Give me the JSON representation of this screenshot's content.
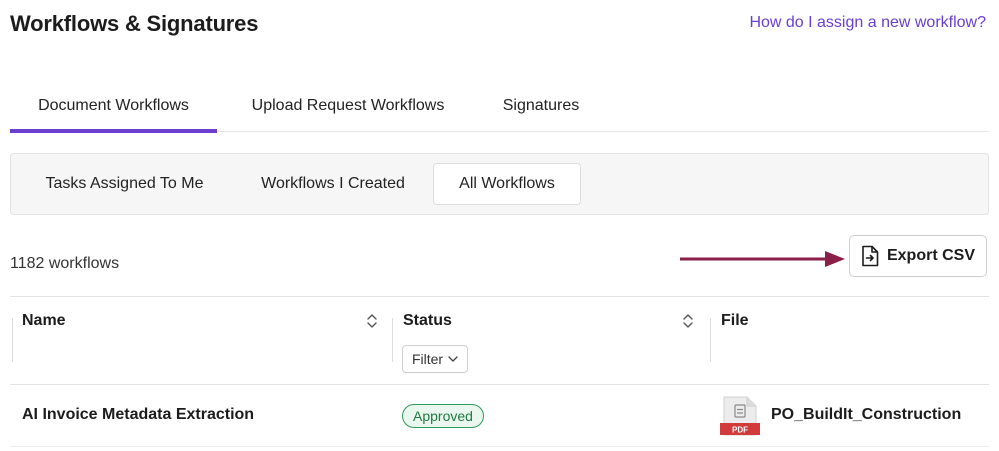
{
  "header": {
    "title": "Workflows & Signatures",
    "help_link": "How do I assign a new workflow?"
  },
  "tabs": [
    {
      "label": "Document Workflows",
      "active": true
    },
    {
      "label": "Upload Request Workflows",
      "active": false
    },
    {
      "label": "Signatures",
      "active": false
    }
  ],
  "subtabs": [
    {
      "label": "Tasks Assigned To Me",
      "active": false
    },
    {
      "label": "Workflows I Created",
      "active": false
    },
    {
      "label": "All Workflows",
      "active": true
    }
  ],
  "summary": {
    "count_text": "1182 workflows",
    "export_label": "Export CSV"
  },
  "table": {
    "columns": [
      "Name",
      "Status",
      "File"
    ],
    "filter_label": "Filter",
    "rows": [
      {
        "name": "AI Invoice Metadata Extraction",
        "status": "Approved",
        "file_type": "PDF",
        "file": "PO_BuildIt_Construction"
      }
    ]
  },
  "colors": {
    "accent": "#6a3fd0",
    "arrow": "#8a1f4a",
    "approved_border": "#2e9a5b",
    "approved_bg": "#e9f7ee",
    "pdf_red": "#d13b3b"
  },
  "icons": [
    "export-file-icon",
    "sort-icon",
    "chevron-down-icon",
    "pdf-file-icon",
    "arrow-right-icon"
  ]
}
